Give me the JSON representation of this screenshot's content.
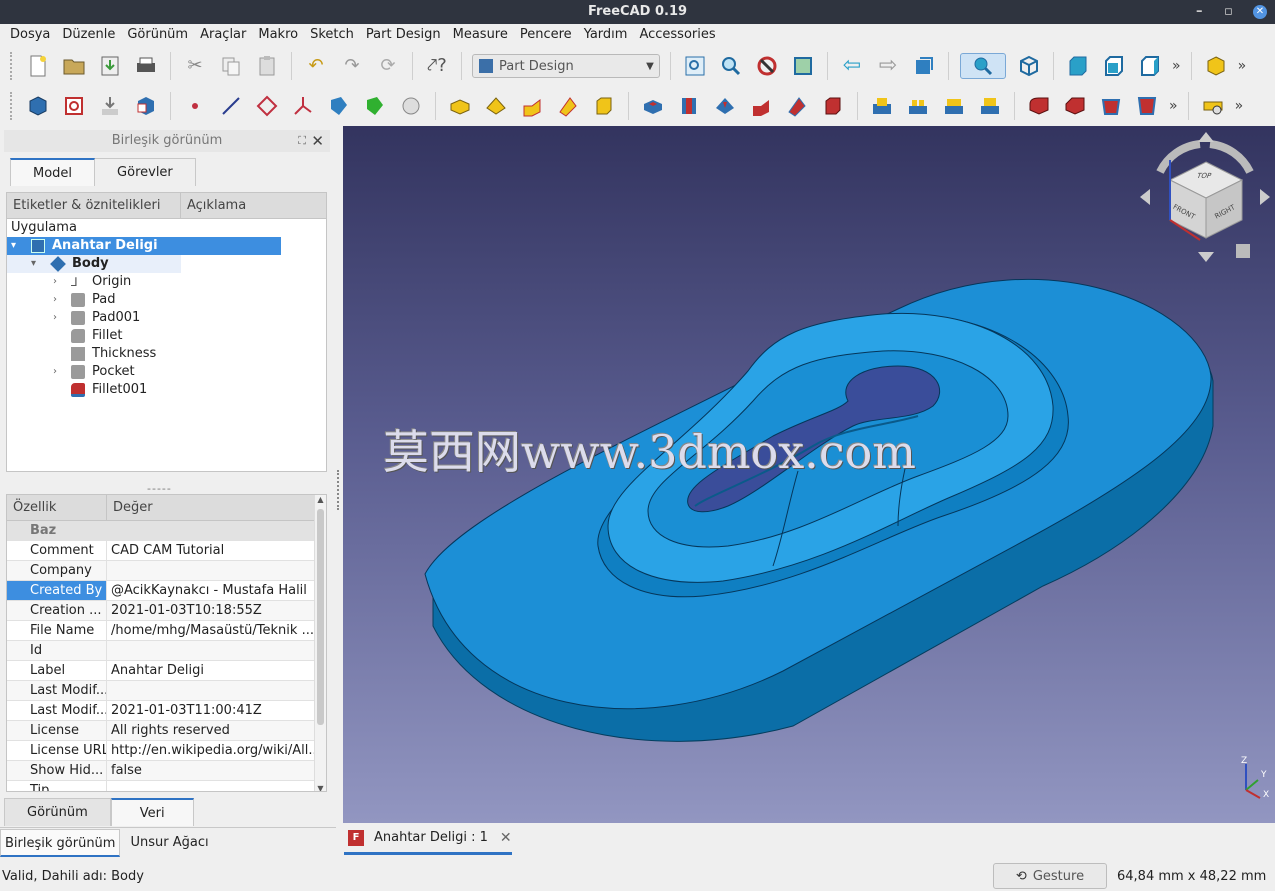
{
  "window": {
    "title": "FreeCAD 0.19",
    "minimize": "–",
    "restore": "▫"
  },
  "menu": [
    "Dosya",
    "Düzenle",
    "Görünüm",
    "Araçlar",
    "Makro",
    "Sketch",
    "Part Design",
    "Measure",
    "Pencere",
    "Yardım",
    "Accessories"
  ],
  "toolbar": {
    "workbench": "Part Design"
  },
  "combo_view": {
    "title": "Birleşik görünüm",
    "tabs": [
      "Model",
      "Görevler"
    ],
    "tree_headers": [
      "Etiketler & öznitelikleri",
      "Açıklama"
    ],
    "tree_root": "Uygulama",
    "doc": "Anahtar Deligi",
    "body": "Body",
    "features": [
      "Origin",
      "Pad",
      "Pad001",
      "Fillet",
      "Thickness",
      "Pocket",
      "Fillet001"
    ],
    "splitter": "-----",
    "prop_headers": [
      "Özellik",
      "Değer"
    ],
    "prop_group": "Baz",
    "properties": [
      {
        "k": "Comment",
        "v": "CAD CAM Tutorial"
      },
      {
        "k": "Company",
        "v": ""
      },
      {
        "k": "Created By",
        "v": "@AcikKaynakcı - Mustafa Halil"
      },
      {
        "k": "Creation ...",
        "v": "2021-01-03T10:18:55Z"
      },
      {
        "k": "File Name",
        "v": "/home/mhg/Masaüstü/Teknik ..."
      },
      {
        "k": "Id",
        "v": ""
      },
      {
        "k": "Label",
        "v": "Anahtar Deligi"
      },
      {
        "k": "Last Modif...",
        "v": ""
      },
      {
        "k": "Last Modif...",
        "v": "2021-01-03T11:00:41Z"
      },
      {
        "k": "License",
        "v": "All rights reserved"
      },
      {
        "k": "License URL",
        "v": "http://en.wikipedia.org/wiki/All..."
      },
      {
        "k": "Show Hid...",
        "v": "false"
      },
      {
        "k": "Tip",
        "v": ""
      }
    ],
    "bottom_tabs": [
      "Görünüm",
      "Veri"
    ],
    "panel_tabs": [
      "Birleşik görünüm",
      "Unsur Ağacı"
    ]
  },
  "viewport": {
    "watermark": "莫西网www.3dmox.com",
    "navcube": {
      "top": "TOP",
      "front": "FRONT",
      "right": "RIGHT"
    },
    "axes": {
      "x": "X",
      "y": "Y",
      "z": "Z"
    },
    "color_body": "#1c8fd6"
  },
  "doc_tab": "Anahtar Deligi : 1",
  "status": {
    "message": "Valid, Dahili adı: Body",
    "nav_style": "Gesture",
    "dimensions": "64,84 mm x 48,22 mm"
  }
}
